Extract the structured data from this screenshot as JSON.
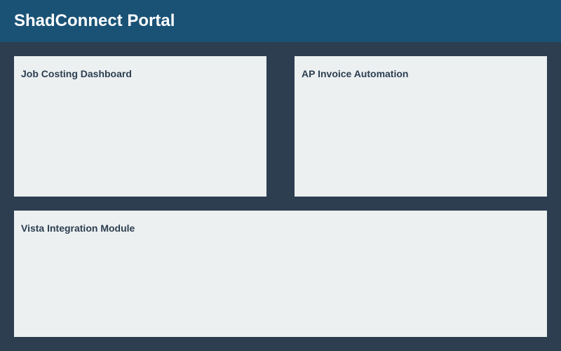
{
  "header": {
    "title": "ShadConnect Portal"
  },
  "panels": [
    {
      "title": "Job Costing Dashboard"
    },
    {
      "title": "AP Invoice Automation"
    },
    {
      "title": "Vista Integration Module"
    }
  ]
}
